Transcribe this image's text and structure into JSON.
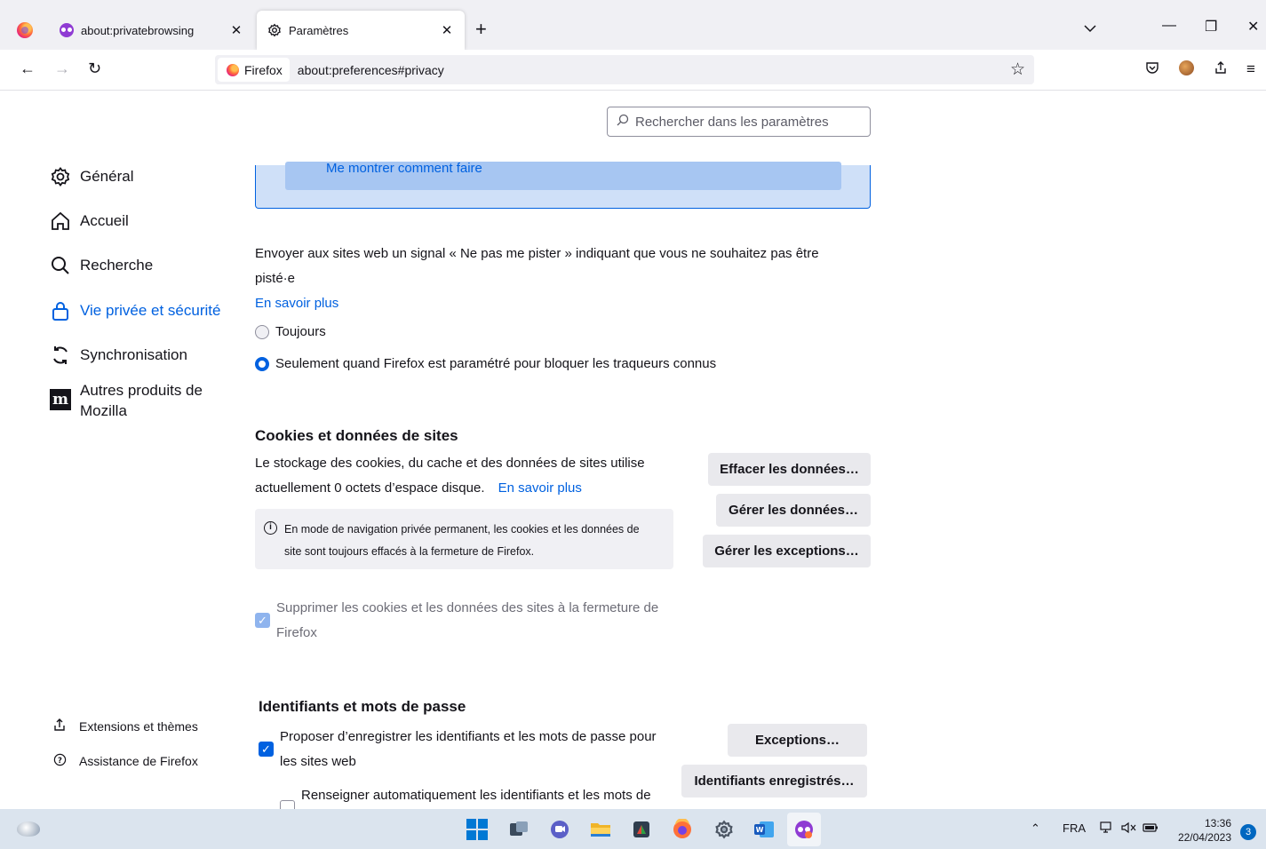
{
  "tabs": [
    {
      "title": "about:privatebrowsing",
      "icon": "private-browsing-icon"
    },
    {
      "title": "Paramètres",
      "icon": "gear-icon",
      "active": true
    }
  ],
  "urlbar": {
    "identity_label": "Firefox",
    "url": "about:preferences#privacy"
  },
  "search": {
    "placeholder": "Rechercher dans les paramètres"
  },
  "sidebar": {
    "items": [
      {
        "label": "Général",
        "icon": "gear-icon"
      },
      {
        "label": "Accueil",
        "icon": "home-icon"
      },
      {
        "label": "Recherche",
        "icon": "search-icon"
      },
      {
        "label": "Vie privée et sécurité",
        "icon": "lock-icon",
        "active": true
      },
      {
        "label": "Synchronisation",
        "icon": "sync-icon"
      },
      {
        "label_line1": "Autres produits de",
        "label_line2": "Mozilla",
        "icon": "mozilla-icon"
      }
    ],
    "footer": [
      {
        "label": "Extensions et thèmes",
        "icon": "extensions-icon"
      },
      {
        "label": "Assistance de Firefox",
        "icon": "help-icon"
      }
    ]
  },
  "info_panel": {
    "button_label": "Me montrer comment faire"
  },
  "dnt": {
    "line1": "Envoyer aux sites web un signal « Ne pas me pister » indiquant que vous ne souhaitez pas être",
    "line2": "pisté·e",
    "learn_more": "En savoir plus",
    "options": [
      {
        "label": "Toujours",
        "selected": false
      },
      {
        "label": "Seulement quand Firefox est paramétré pour bloquer les traqueurs connus",
        "selected": true
      }
    ]
  },
  "cookies": {
    "heading": "Cookies et données de sites",
    "desc_line1": "Le stockage des cookies, du cache et des données de sites utilise",
    "desc_line2": "actuellement 0 octets d’espace disque.",
    "learn_more": "En savoir plus",
    "note_line1": "En mode de navigation privée permanent, les cookies et les données de",
    "note_line2": "site sont toujours effacés à la fermeture de Firefox.",
    "buttons": {
      "clear": "Effacer les données…",
      "manage": "Gérer les données…",
      "exceptions": "Gérer les exceptions…"
    },
    "delete_on_close_line1": "Supprimer les cookies et les données des sites à la fermeture de",
    "delete_on_close_line2": "Firefox",
    "delete_on_close_checked": true
  },
  "logins": {
    "heading": "Identifiants et mots de passe",
    "offer_save_line1": "Proposer d’enregistrer les identifiants et les mots de passe pour",
    "offer_save_line2": "les sites web",
    "offer_save_checked": true,
    "autofill_line1": "Renseigner automatiquement les identifiants et les mots de",
    "autofill_checked": false,
    "buttons": {
      "exceptions": "Exceptions…",
      "saved_logins": "Identifiants enregistrés…"
    }
  },
  "taskbar": {
    "language": "FRA",
    "time": "13:36",
    "date": "22/04/2023",
    "notification_count": "3"
  },
  "colors": {
    "accent": "#0061e0",
    "tabstrip": "#f0f0f4",
    "taskbar": "#dbe4ee"
  }
}
